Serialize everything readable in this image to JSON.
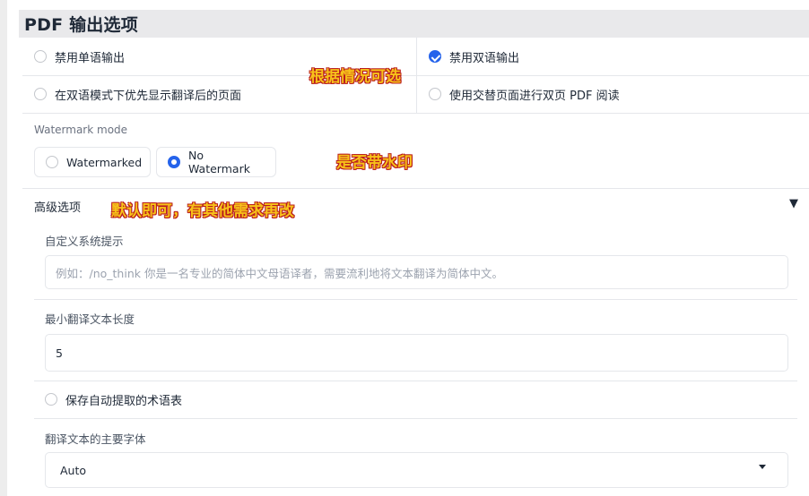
{
  "section_title": "PDF 输出选项",
  "options_row1": {
    "left_label": "禁用单语输出",
    "left_checked": false,
    "right_label": "禁用双语输出",
    "right_checked": true
  },
  "options_row2": {
    "left_label": "在双语模式下优先显示翻译后的页面",
    "left_checked": false,
    "right_label": "使用交替页面进行双页 PDF 阅读",
    "right_checked": false
  },
  "watermark": {
    "label": "Watermark mode",
    "options": [
      "Watermarked",
      "No Watermark"
    ],
    "selected": "No Watermark"
  },
  "advanced": {
    "title": "高级选项",
    "toggle_symbol": "▼",
    "system_prompt": {
      "label": "自定义系统提示",
      "placeholder": "例如：/no_think 你是一名专业的简体中文母语译者，需要流利地将文本翻译为简体中文。",
      "value": ""
    },
    "min_length": {
      "label": "最小翻译文本长度",
      "value": "5"
    },
    "save_glossary": {
      "label": "保存自动提取的术语表",
      "checked": false
    },
    "font": {
      "label": "翻译文本的主要字体",
      "value": "Auto"
    }
  },
  "annotations": {
    "a1": "根据情况可选",
    "a2": "是否带水印",
    "a3": "默认即可，有其他需求再改"
  },
  "colors": {
    "accent": "#2563eb",
    "annotation_fill": "#f7c21a",
    "annotation_outline": "#b91c1c",
    "header_bg": "#e9e9eb"
  }
}
